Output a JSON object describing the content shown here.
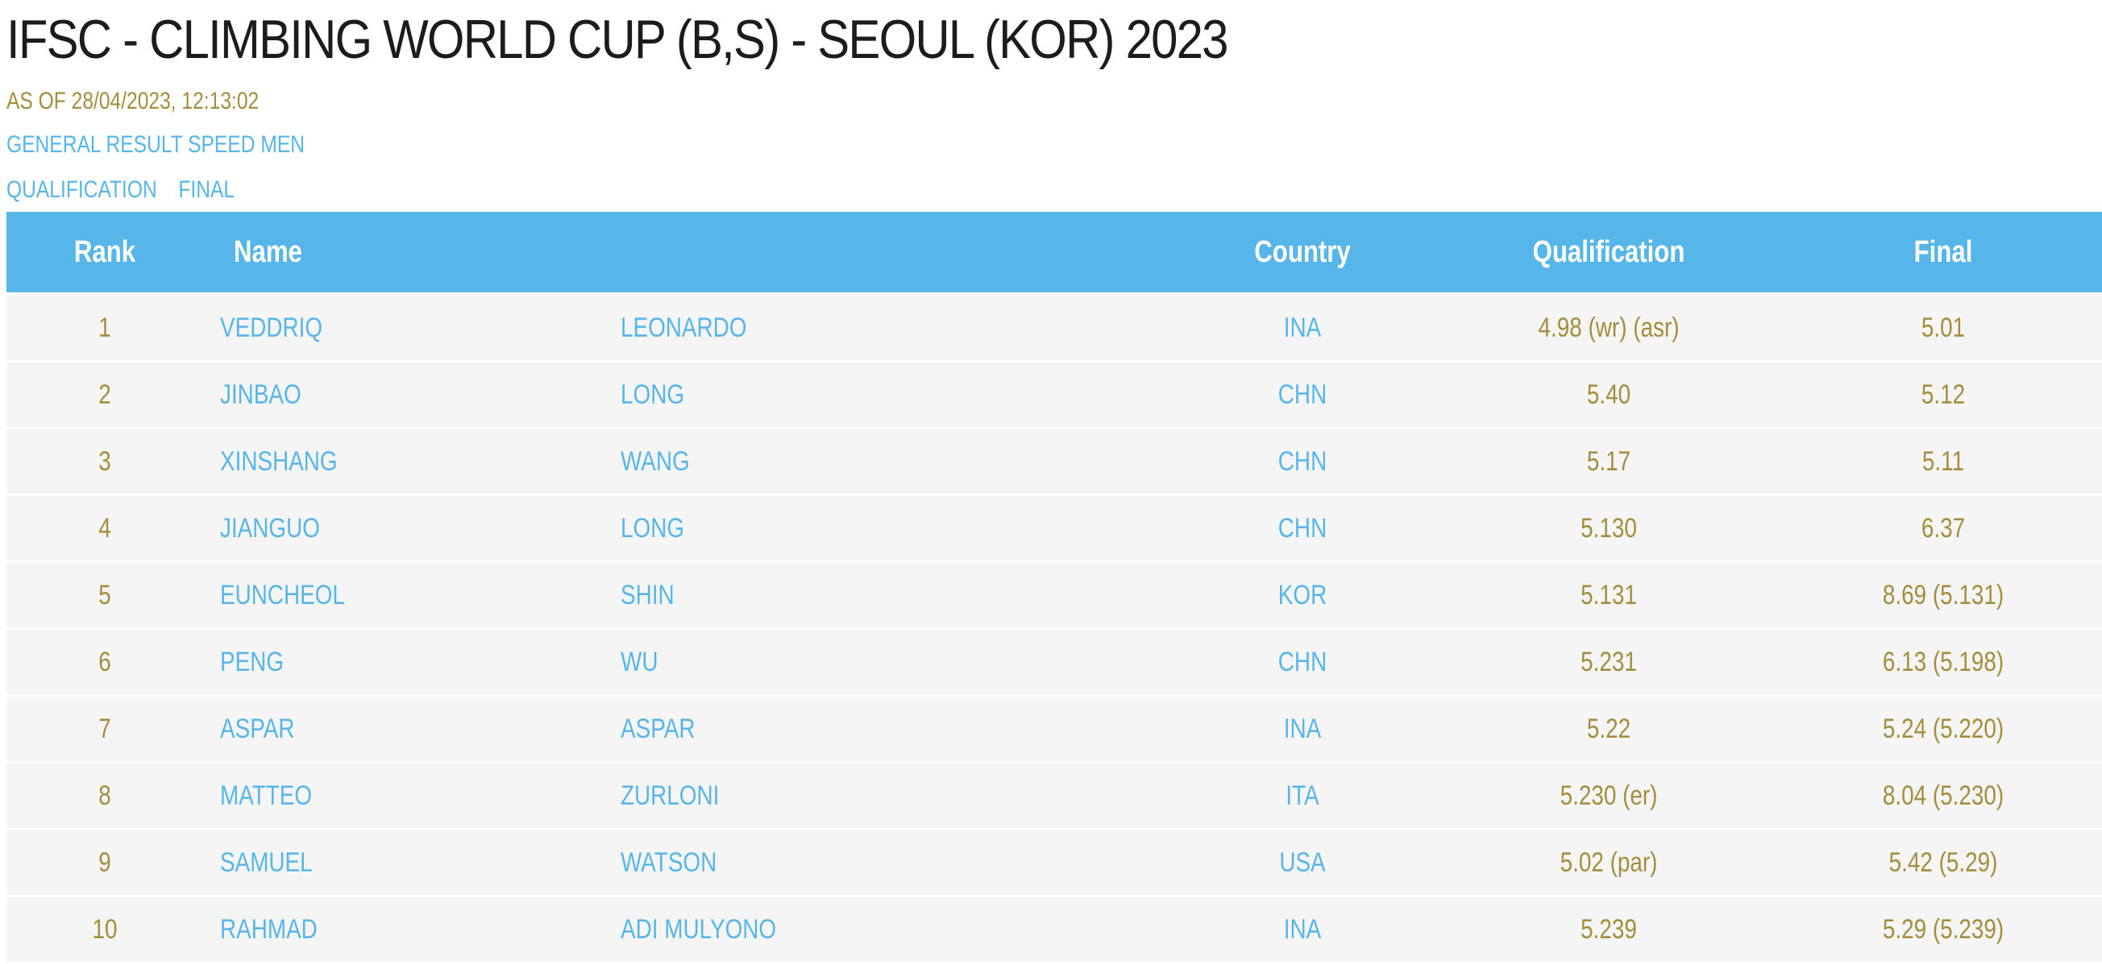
{
  "header": {
    "title": "IFSC - CLIMBING WORLD CUP (B,S) - SEOUL (KOR) 2023",
    "as_of": "AS OF 28/04/2023, 12:13:02",
    "subtitle": "GENERAL RESULT SPEED MEN",
    "filters": [
      "QUALIFICATION",
      "FINAL"
    ]
  },
  "colors": {
    "accent_blue": "#56b6e9",
    "gold": "#a48d3c",
    "row_bg": "#f5f5f5",
    "title": "#1c1c1c"
  },
  "table": {
    "columns": {
      "rank": "Rank",
      "name": "Name",
      "country": "Country",
      "qualification": "Qualification",
      "final": "Final"
    },
    "rows": [
      {
        "rank": "1",
        "first": "VEDDRIQ",
        "last": "LEONARDO",
        "country": "INA",
        "qualification": "4.98 (wr) (asr)",
        "final": "5.01"
      },
      {
        "rank": "2",
        "first": "JINBAO",
        "last": "LONG",
        "country": "CHN",
        "qualification": "5.40",
        "final": "5.12"
      },
      {
        "rank": "3",
        "first": "XINSHANG",
        "last": "WANG",
        "country": "CHN",
        "qualification": "5.17",
        "final": "5.11"
      },
      {
        "rank": "4",
        "first": "JIANGUO",
        "last": "LONG",
        "country": "CHN",
        "qualification": "5.130",
        "final": "6.37"
      },
      {
        "rank": "5",
        "first": "EUNCHEOL",
        "last": "SHIN",
        "country": "KOR",
        "qualification": "5.131",
        "final": "8.69 (5.131)"
      },
      {
        "rank": "6",
        "first": "PENG",
        "last": "WU",
        "country": "CHN",
        "qualification": "5.231",
        "final": "6.13 (5.198)"
      },
      {
        "rank": "7",
        "first": "ASPAR",
        "last": "ASPAR",
        "country": "INA",
        "qualification": "5.22",
        "final": "5.24 (5.220)"
      },
      {
        "rank": "8",
        "first": "MATTEO",
        "last": "ZURLONI",
        "country": "ITA",
        "qualification": "5.230 (er)",
        "final": "8.04 (5.230)"
      },
      {
        "rank": "9",
        "first": "SAMUEL",
        "last": "WATSON",
        "country": "USA",
        "qualification": "5.02 (par)",
        "final": "5.42 (5.29)"
      },
      {
        "rank": "10",
        "first": "RAHMAD",
        "last": "ADI MULYONO",
        "country": "INA",
        "qualification": "5.239",
        "final": "5.29 (5.239)"
      }
    ]
  }
}
